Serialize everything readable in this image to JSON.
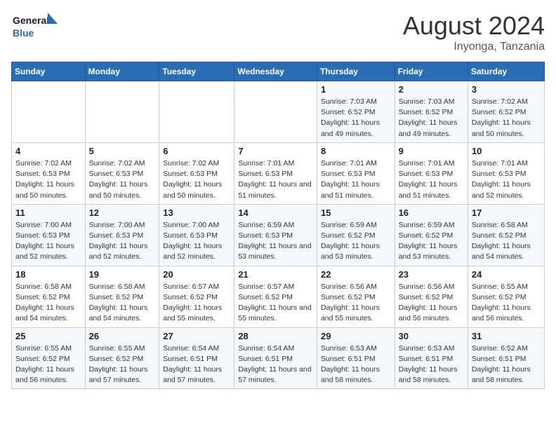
{
  "header": {
    "logo_line1": "General",
    "logo_line2": "Blue",
    "month_year": "August 2024",
    "location": "Inyonga, Tanzania"
  },
  "days_of_week": [
    "Sunday",
    "Monday",
    "Tuesday",
    "Wednesday",
    "Thursday",
    "Friday",
    "Saturday"
  ],
  "weeks": [
    [
      {
        "day": "",
        "sunrise": "",
        "sunset": "",
        "daylight": ""
      },
      {
        "day": "",
        "sunrise": "",
        "sunset": "",
        "daylight": ""
      },
      {
        "day": "",
        "sunrise": "",
        "sunset": "",
        "daylight": ""
      },
      {
        "day": "",
        "sunrise": "",
        "sunset": "",
        "daylight": ""
      },
      {
        "day": "1",
        "sunrise": "Sunrise: 7:03 AM",
        "sunset": "Sunset: 6:52 PM",
        "daylight": "Daylight: 11 hours and 49 minutes."
      },
      {
        "day": "2",
        "sunrise": "Sunrise: 7:03 AM",
        "sunset": "Sunset: 6:52 PM",
        "daylight": "Daylight: 11 hours and 49 minutes."
      },
      {
        "day": "3",
        "sunrise": "Sunrise: 7:02 AM",
        "sunset": "Sunset: 6:52 PM",
        "daylight": "Daylight: 11 hours and 50 minutes."
      }
    ],
    [
      {
        "day": "4",
        "sunrise": "Sunrise: 7:02 AM",
        "sunset": "Sunset: 6:53 PM",
        "daylight": "Daylight: 11 hours and 50 minutes."
      },
      {
        "day": "5",
        "sunrise": "Sunrise: 7:02 AM",
        "sunset": "Sunset: 6:53 PM",
        "daylight": "Daylight: 11 hours and 50 minutes."
      },
      {
        "day": "6",
        "sunrise": "Sunrise: 7:02 AM",
        "sunset": "Sunset: 6:53 PM",
        "daylight": "Daylight: 11 hours and 50 minutes."
      },
      {
        "day": "7",
        "sunrise": "Sunrise: 7:01 AM",
        "sunset": "Sunset: 6:53 PM",
        "daylight": "Daylight: 11 hours and 51 minutes."
      },
      {
        "day": "8",
        "sunrise": "Sunrise: 7:01 AM",
        "sunset": "Sunset: 6:53 PM",
        "daylight": "Daylight: 11 hours and 51 minutes."
      },
      {
        "day": "9",
        "sunrise": "Sunrise: 7:01 AM",
        "sunset": "Sunset: 6:53 PM",
        "daylight": "Daylight: 11 hours and 51 minutes."
      },
      {
        "day": "10",
        "sunrise": "Sunrise: 7:01 AM",
        "sunset": "Sunset: 6:53 PM",
        "daylight": "Daylight: 11 hours and 52 minutes."
      }
    ],
    [
      {
        "day": "11",
        "sunrise": "Sunrise: 7:00 AM",
        "sunset": "Sunset: 6:53 PM",
        "daylight": "Daylight: 11 hours and 52 minutes."
      },
      {
        "day": "12",
        "sunrise": "Sunrise: 7:00 AM",
        "sunset": "Sunset: 6:53 PM",
        "daylight": "Daylight: 11 hours and 52 minutes."
      },
      {
        "day": "13",
        "sunrise": "Sunrise: 7:00 AM",
        "sunset": "Sunset: 6:53 PM",
        "daylight": "Daylight: 11 hours and 52 minutes."
      },
      {
        "day": "14",
        "sunrise": "Sunrise: 6:59 AM",
        "sunset": "Sunset: 6:53 PM",
        "daylight": "Daylight: 11 hours and 53 minutes."
      },
      {
        "day": "15",
        "sunrise": "Sunrise: 6:59 AM",
        "sunset": "Sunset: 6:52 PM",
        "daylight": "Daylight: 11 hours and 53 minutes."
      },
      {
        "day": "16",
        "sunrise": "Sunrise: 6:59 AM",
        "sunset": "Sunset: 6:52 PM",
        "daylight": "Daylight: 11 hours and 53 minutes."
      },
      {
        "day": "17",
        "sunrise": "Sunrise: 6:58 AM",
        "sunset": "Sunset: 6:52 PM",
        "daylight": "Daylight: 11 hours and 54 minutes."
      }
    ],
    [
      {
        "day": "18",
        "sunrise": "Sunrise: 6:58 AM",
        "sunset": "Sunset: 6:52 PM",
        "daylight": "Daylight: 11 hours and 54 minutes."
      },
      {
        "day": "19",
        "sunrise": "Sunrise: 6:58 AM",
        "sunset": "Sunset: 6:52 PM",
        "daylight": "Daylight: 11 hours and 54 minutes."
      },
      {
        "day": "20",
        "sunrise": "Sunrise: 6:57 AM",
        "sunset": "Sunset: 6:52 PM",
        "daylight": "Daylight: 11 hours and 55 minutes."
      },
      {
        "day": "21",
        "sunrise": "Sunrise: 6:57 AM",
        "sunset": "Sunset: 6:52 PM",
        "daylight": "Daylight: 11 hours and 55 minutes."
      },
      {
        "day": "22",
        "sunrise": "Sunrise: 6:56 AM",
        "sunset": "Sunset: 6:52 PM",
        "daylight": "Daylight: 11 hours and 55 minutes."
      },
      {
        "day": "23",
        "sunrise": "Sunrise: 6:56 AM",
        "sunset": "Sunset: 6:52 PM",
        "daylight": "Daylight: 11 hours and 56 minutes."
      },
      {
        "day": "24",
        "sunrise": "Sunrise: 6:55 AM",
        "sunset": "Sunset: 6:52 PM",
        "daylight": "Daylight: 11 hours and 56 minutes."
      }
    ],
    [
      {
        "day": "25",
        "sunrise": "Sunrise: 6:55 AM",
        "sunset": "Sunset: 6:52 PM",
        "daylight": "Daylight: 11 hours and 56 minutes."
      },
      {
        "day": "26",
        "sunrise": "Sunrise: 6:55 AM",
        "sunset": "Sunset: 6:52 PM",
        "daylight": "Daylight: 11 hours and 57 minutes."
      },
      {
        "day": "27",
        "sunrise": "Sunrise: 6:54 AM",
        "sunset": "Sunset: 6:51 PM",
        "daylight": "Daylight: 11 hours and 57 minutes."
      },
      {
        "day": "28",
        "sunrise": "Sunrise: 6:54 AM",
        "sunset": "Sunset: 6:51 PM",
        "daylight": "Daylight: 11 hours and 57 minutes."
      },
      {
        "day": "29",
        "sunrise": "Sunrise: 6:53 AM",
        "sunset": "Sunset: 6:51 PM",
        "daylight": "Daylight: 11 hours and 58 minutes."
      },
      {
        "day": "30",
        "sunrise": "Sunrise: 6:53 AM",
        "sunset": "Sunset: 6:51 PM",
        "daylight": "Daylight: 11 hours and 58 minutes."
      },
      {
        "day": "31",
        "sunrise": "Sunrise: 6:52 AM",
        "sunset": "Sunset: 6:51 PM",
        "daylight": "Daylight: 11 hours and 58 minutes."
      }
    ]
  ]
}
